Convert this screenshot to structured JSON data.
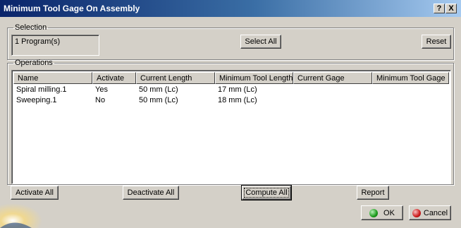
{
  "window": {
    "title": "Minimum Tool Gage On Assembly",
    "help_label": "?",
    "close_label": "X"
  },
  "selection": {
    "legend": "Selection",
    "value": "1 Program(s)",
    "select_all_label": "Select All",
    "reset_label": "Reset"
  },
  "operations": {
    "legend": "Operations",
    "columns": [
      "Name",
      "Activate",
      "Current Length",
      "Minimum Tool Length",
      "Current Gage",
      "Minimum Tool Gage"
    ],
    "rows": [
      [
        "Spiral milling.1",
        "Yes",
        "50 mm (Lc)",
        "17 mm (Lc)",
        "",
        ""
      ],
      [
        "Sweeping.1",
        "No",
        "50 mm (Lc)",
        "18 mm (Lc)",
        "",
        ""
      ]
    ]
  },
  "actions": {
    "activate_all_label": "Activate All",
    "deactivate_all_label": "Deactivate All",
    "compute_all_label": "Compute All",
    "report_label": "Report"
  },
  "dialog": {
    "ok_label": "OK",
    "cancel_label": "Cancel",
    "ok_color": "#1a9a1a",
    "cancel_color": "#cc1a1a"
  }
}
